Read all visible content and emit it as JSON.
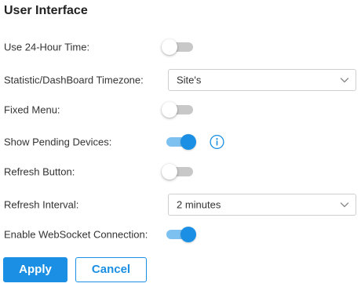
{
  "section": {
    "title": "User Interface"
  },
  "settings": {
    "use_24_hour_time": {
      "label": "Use 24-Hour Time:",
      "enabled": false
    },
    "timezone": {
      "label": "Statistic/DashBoard Timezone:",
      "selected": "Site's"
    },
    "fixed_menu": {
      "label": "Fixed Menu:",
      "enabled": false
    },
    "show_pending_devices": {
      "label": "Show Pending Devices:",
      "enabled": true,
      "info_icon": "info-icon"
    },
    "refresh_button": {
      "label": "Refresh Button:",
      "enabled": false
    },
    "refresh_interval": {
      "label": "Refresh Interval:",
      "selected": "2 minutes"
    },
    "enable_websocket": {
      "label": "Enable WebSocket Connection:",
      "enabled": true
    }
  },
  "actions": {
    "apply_label": "Apply",
    "cancel_label": "Cancel"
  },
  "colors": {
    "accent": "#1a8fe3",
    "toggle_on_track": "#7cc1f0",
    "toggle_off_track": "#c8c8c8",
    "border": "#cfcfcf",
    "text": "#333333"
  }
}
